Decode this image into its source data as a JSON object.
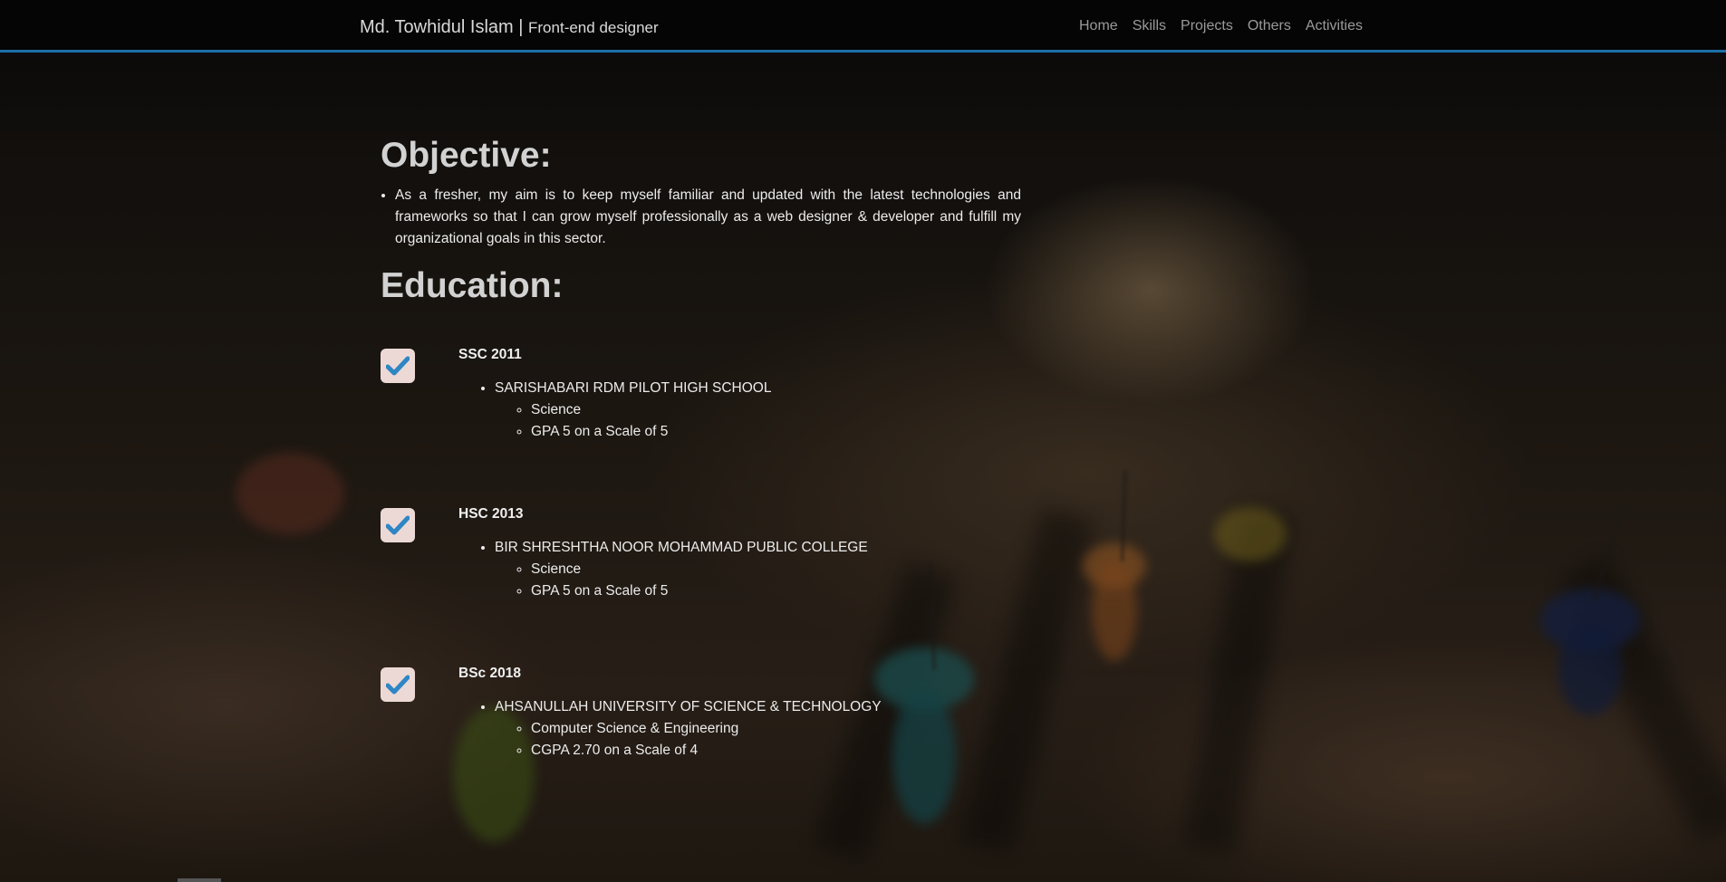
{
  "navbar": {
    "brand_name": "Md. Towhidul Islam |",
    "brand_role": "Front-end designer",
    "links": [
      "Home",
      "Skills",
      "Projects",
      "Others",
      "Activities"
    ]
  },
  "objective": {
    "heading": "Objective:",
    "text": "As a fresher, my aim is to keep myself familiar and updated with the latest technologies and frameworks so that I can grow myself professionally as a web designer & developer and fulfill my organizational goals in this sector."
  },
  "education": {
    "heading": "Education:",
    "items": [
      {
        "title": "SSC 2011",
        "institution": "SARISHABARI RDM PILOT HIGH SCHOOL",
        "details": [
          "Science",
          "GPA 5 on a Scale of 5"
        ]
      },
      {
        "title": "HSC 2013",
        "institution": "BIR SHRESHTHA NOOR MOHAMMAD PUBLIC COLLEGE",
        "details": [
          "Science",
          "GPA 5 on a Scale of 5"
        ]
      },
      {
        "title": "BSc 2018",
        "institution": "AHSANULLAH UNIVERSITY OF SCIENCE & TECHNOLOGY",
        "details": [
          "Computer Science & Engineering",
          "CGPA 2.70 on a Scale of 4"
        ]
      }
    ]
  },
  "colors": {
    "accent": "#1b6fa8",
    "check": "#2f86c4"
  },
  "icons": {
    "check": "check-icon"
  }
}
